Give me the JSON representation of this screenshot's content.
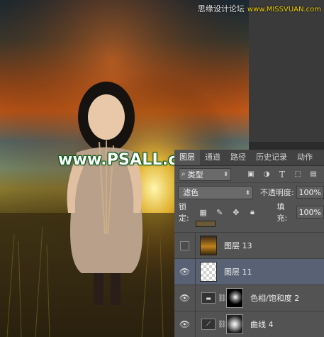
{
  "watermark_top": {
    "text": "思缘设计论坛",
    "sub": "www.MISSVUAN.com"
  },
  "watermark_main": "www.PSALL.com",
  "colors": {
    "panel_bg": "#535353",
    "tab_bar": "#424242",
    "selected_row": "#596174",
    "watermark_outline": "#0a5a1a"
  },
  "layers_panel": {
    "tabs": [
      {
        "label": "图层",
        "active": true
      },
      {
        "label": "通道",
        "active": false
      },
      {
        "label": "路径",
        "active": false
      },
      {
        "label": "历史记录",
        "active": false
      },
      {
        "label": "动作",
        "active": false
      }
    ],
    "filter_kind": "类型",
    "filter_icons": [
      "image-filter-icon",
      "adjustment-filter-icon",
      "type-filter-icon",
      "shape-filter-icon",
      "smart-object-filter-icon"
    ],
    "blend_mode": "滤色",
    "opacity_label": "不透明度:",
    "opacity_value": "100%",
    "lock_label": "锁定:",
    "lock_icons": [
      "lock-transparent-icon",
      "lock-paint-icon",
      "lock-move-icon",
      "lock-all-icon"
    ],
    "fill_label": "填充:",
    "fill_value": "100%",
    "layers": [
      {
        "name": "图层 13",
        "visible": false,
        "selected": false
      },
      {
        "name": "图层 11",
        "visible": true,
        "selected": true
      },
      {
        "name": "色相/饱和度 2",
        "visible": true,
        "selected": false
      },
      {
        "name": "曲线 4",
        "visible": true,
        "selected": false
      }
    ]
  }
}
